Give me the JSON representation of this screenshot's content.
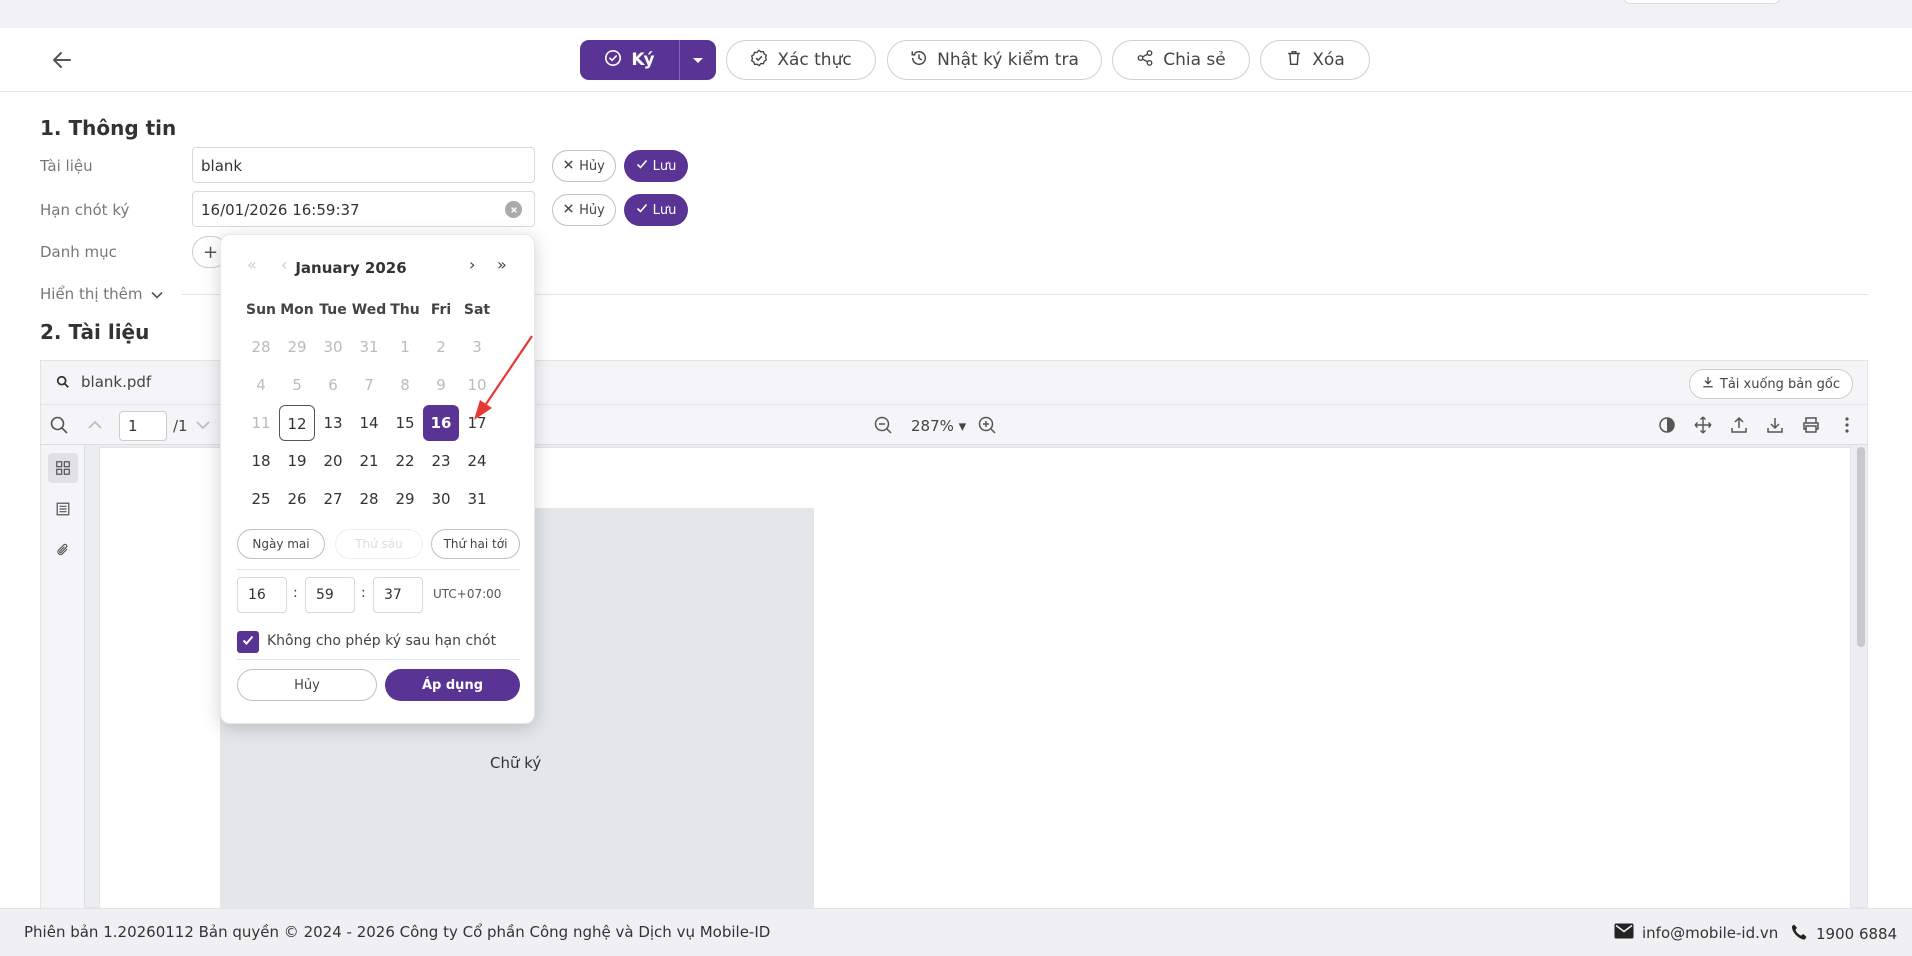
{
  "toolbar": {
    "ky_label": "Ký",
    "verify_label": "Xác thực",
    "audit_label": "Nhật ký kiểm tra",
    "share_label": "Chia sẻ",
    "delete_label": "Xóa"
  },
  "section1": {
    "title": "1. Thông tin",
    "document_label": "Tài liệu",
    "document_value": "blank",
    "deadline_label": "Hạn chót ký",
    "deadline_value": "16/01/2026 16:59:37",
    "category_label": "Danh mục",
    "category_add": "+",
    "show_more_label": "Hiển thị thêm",
    "cancel_label": "Hủy",
    "save_label": "Lưu"
  },
  "section2": {
    "title": "2. Tài liệu",
    "file_name": "blank.pdf",
    "download_label": "Tải xuống bản gốc",
    "page_current": "1",
    "page_total": "/1",
    "zoom": "287%",
    "signature_label": "Chữ ký"
  },
  "datepicker": {
    "title": "January 2026",
    "nav": {
      "prev_year": "«",
      "prev_month": "‹",
      "next_month": "›",
      "next_year": "»"
    },
    "weekdays": [
      "Sun",
      "Mon",
      "Tue",
      "Wed",
      "Thu",
      "Fri",
      "Sat"
    ],
    "weeks": [
      [
        {
          "label": "28",
          "state": "muted"
        },
        {
          "label": "29",
          "state": "muted"
        },
        {
          "label": "30",
          "state": "muted"
        },
        {
          "label": "31",
          "state": "muted"
        },
        {
          "label": "1",
          "state": "disabled"
        },
        {
          "label": "2",
          "state": "disabled"
        },
        {
          "label": "3",
          "state": "disabled"
        }
      ],
      [
        {
          "label": "4",
          "state": "disabled"
        },
        {
          "label": "5",
          "state": "disabled"
        },
        {
          "label": "6",
          "state": "disabled"
        },
        {
          "label": "7",
          "state": "disabled"
        },
        {
          "label": "8",
          "state": "disabled"
        },
        {
          "label": "9",
          "state": "disabled"
        },
        {
          "label": "10",
          "state": "disabled"
        }
      ],
      [
        {
          "label": "11",
          "state": "disabled"
        },
        {
          "label": "12",
          "state": "today"
        },
        {
          "label": "13",
          "state": "normal"
        },
        {
          "label": "14",
          "state": "normal"
        },
        {
          "label": "15",
          "state": "normal"
        },
        {
          "label": "16",
          "state": "selected"
        },
        {
          "label": "17",
          "state": "normal"
        }
      ],
      [
        {
          "label": "18",
          "state": "normal"
        },
        {
          "label": "19",
          "state": "normal"
        },
        {
          "label": "20",
          "state": "normal"
        },
        {
          "label": "21",
          "state": "normal"
        },
        {
          "label": "22",
          "state": "normal"
        },
        {
          "label": "23",
          "state": "normal"
        },
        {
          "label": "24",
          "state": "normal"
        }
      ],
      [
        {
          "label": "25",
          "state": "normal"
        },
        {
          "label": "26",
          "state": "normal"
        },
        {
          "label": "27",
          "state": "normal"
        },
        {
          "label": "28",
          "state": "normal"
        },
        {
          "label": "29",
          "state": "normal"
        },
        {
          "label": "30",
          "state": "normal"
        },
        {
          "label": "31",
          "state": "normal"
        }
      ]
    ],
    "quick_tomorrow": "Ngày mai",
    "quick_friday": "Thứ sáu",
    "quick_next_monday": "Thứ hai tới",
    "hour": "16",
    "minute": "59",
    "second": "37",
    "colon": ":",
    "timezone": "UTC+07:00",
    "no_sign_after_deadline": "Không cho phép ký sau hạn chót",
    "cancel_label": "Hủy",
    "apply_label": "Áp dụng"
  },
  "footer": {
    "copyright": "Phiên bản 1.20260112 Bản quyền © 2024 - 2026 Công ty Cổ phần Công nghệ và Dịch vụ Mobile-ID",
    "email": "info@mobile-id.vn",
    "phone": "1900 6884"
  },
  "colors": {
    "primary": "#5a3494",
    "annotation": "#e53935"
  },
  "icons": [
    "back-arrow-icon",
    "check-circle-icon",
    "chevron-down-icon",
    "verified-badge-icon",
    "history-icon",
    "share-icon",
    "trash-icon",
    "close-icon",
    "check-icon",
    "clear-circle-icon",
    "search-icon",
    "download-icon",
    "zoom-out-icon",
    "zoom-in-icon",
    "thumbnails-icon",
    "outline-icon",
    "attachment-icon",
    "mail-icon",
    "phone-icon"
  ]
}
